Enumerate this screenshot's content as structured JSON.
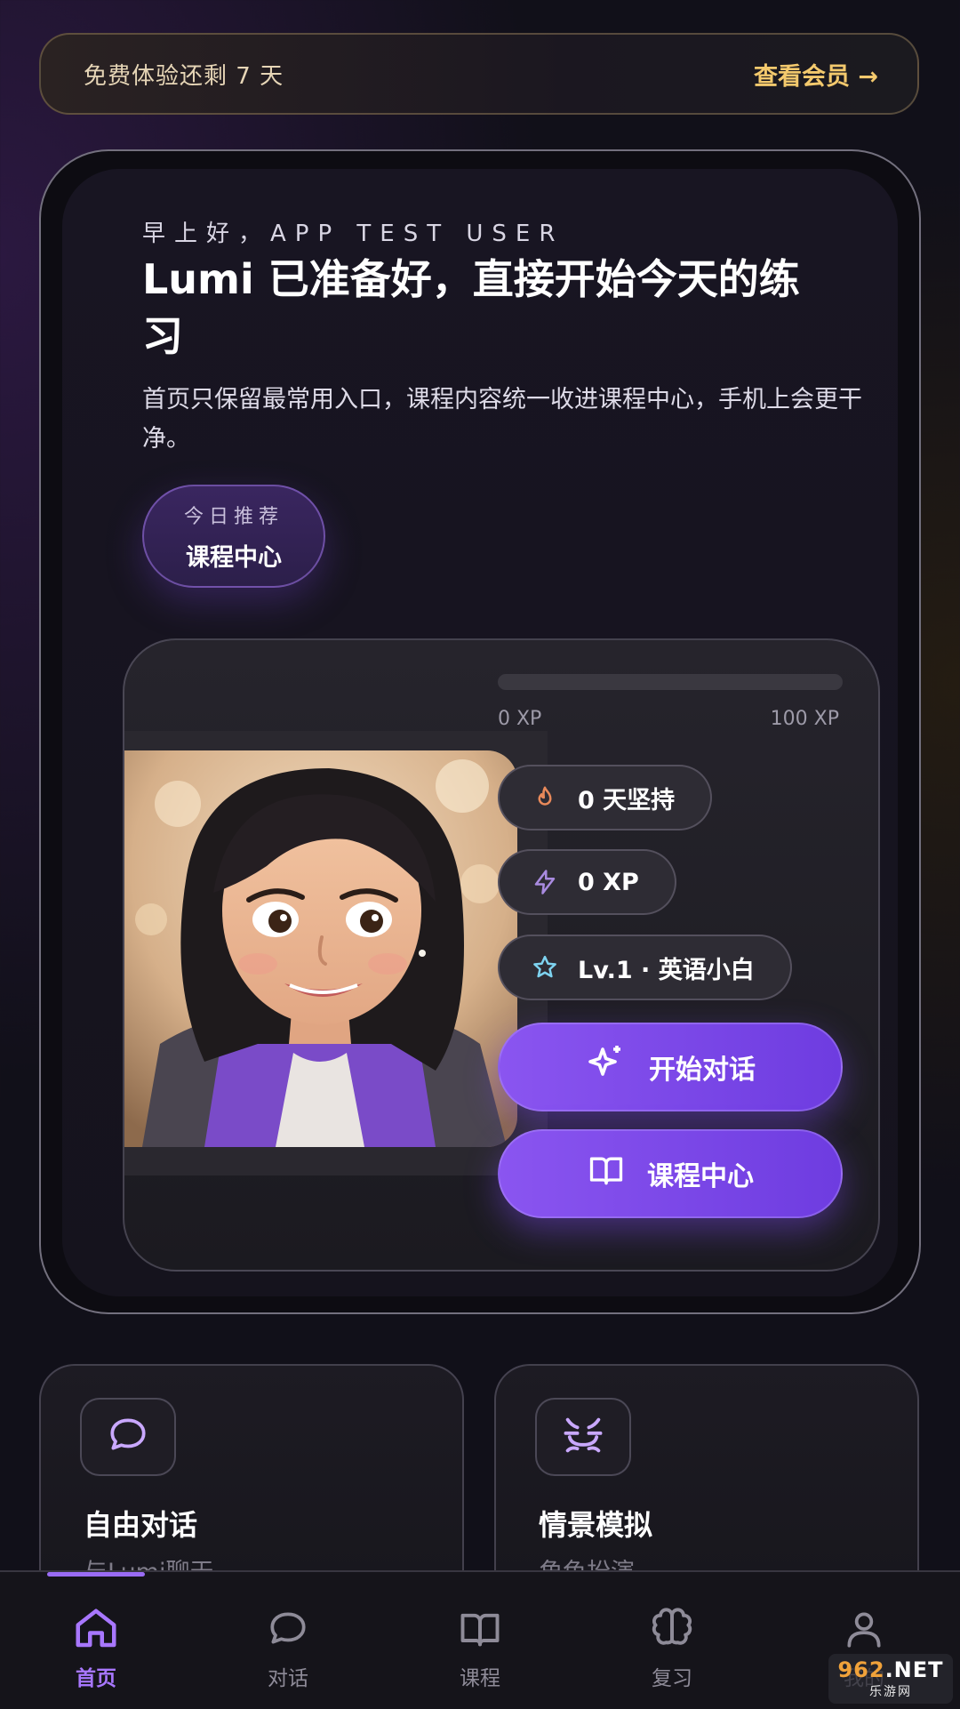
{
  "trial_banner": {
    "text": "免费体验还剩 7 天",
    "link_label": "查看会员 →"
  },
  "hero": {
    "greeting": "早上好，APP TEST USER",
    "title": "Lumi 已准备好，直接开始今天的练习",
    "description": "首页只保留最常用入口，课程内容统一收进课程中心，手机上会更干净。",
    "recommend": {
      "label": "今日推荐",
      "value": "课程中心"
    }
  },
  "progress": {
    "xp_min_label": "0 XP",
    "xp_max_label": "100 XP",
    "xp_fraction": 0.0
  },
  "stats": {
    "streak": "0 天坚持",
    "xp": "0 XP",
    "level": "Lv.1 · 英语小白"
  },
  "actions": {
    "start_chat": "开始对话",
    "course_center": "课程中心"
  },
  "features": [
    {
      "title": "自由对话",
      "subtitle": "与Lumi聊天",
      "icon": "chat-bubble-icon"
    },
    {
      "title": "情景模拟",
      "subtitle": "角色扮演",
      "icon": "role-play-icon"
    }
  ],
  "nav": {
    "items": [
      {
        "label": "首页",
        "icon": "home-icon",
        "active": true
      },
      {
        "label": "对话",
        "icon": "chat-icon",
        "active": false
      },
      {
        "label": "课程",
        "icon": "book-icon",
        "active": false
      },
      {
        "label": "复习",
        "icon": "brain-icon",
        "active": false
      },
      {
        "label": "我的",
        "icon": "user-icon",
        "active": false
      }
    ]
  },
  "watermark": {
    "main_a": "962",
    "main_b": ".NET",
    "sub": "乐游网"
  },
  "colors": {
    "accent": "#8a55f0",
    "gold": "#f3c96d",
    "background": "#111019"
  }
}
